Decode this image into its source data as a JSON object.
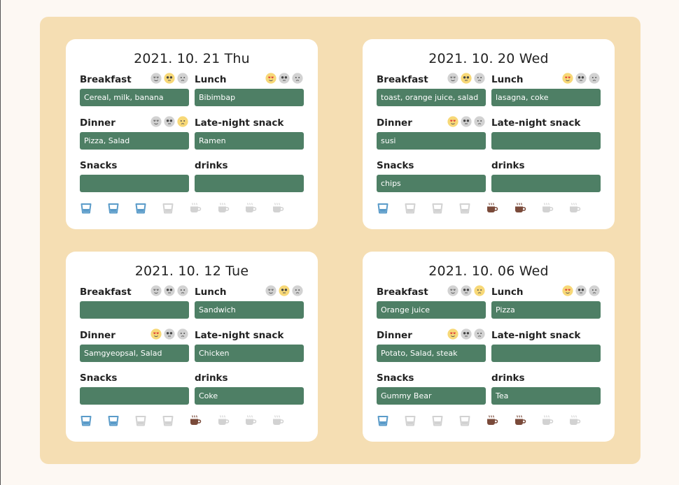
{
  "cards": [
    {
      "date": "2021. 10. 21 Thu",
      "breakfast": {
        "label": "Breakfast",
        "value": "Cereal, milk, banana",
        "mood": "soso"
      },
      "lunch": {
        "label": "Lunch",
        "value": "Bibimbap",
        "mood": "love"
      },
      "dinner": {
        "label": "Dinner",
        "value": "Pizza, Salad",
        "mood": "sad"
      },
      "late_night_snack": {
        "label": "Late-night snack",
        "value": "Ramen"
      },
      "snacks": {
        "label": "Snacks",
        "value": ""
      },
      "drinks": {
        "label": "drinks",
        "value": ""
      },
      "water_cups_filled": 3,
      "water_cups_total": 4,
      "coffee_cups_filled": 0,
      "coffee_cups_total": 4
    },
    {
      "date": "2021. 10. 20 Wed",
      "breakfast": {
        "label": "Breakfast",
        "value": "toast, orange juice, salad",
        "mood": "soso"
      },
      "lunch": {
        "label": "Lunch",
        "value": "lasagna, coke",
        "mood": "love"
      },
      "dinner": {
        "label": "Dinner",
        "value": "susi",
        "mood": "love"
      },
      "late_night_snack": {
        "label": "Late-night snack",
        "value": ""
      },
      "snacks": {
        "label": "Snacks",
        "value": "chips"
      },
      "drinks": {
        "label": "drinks",
        "value": ""
      },
      "water_cups_filled": 1,
      "water_cups_total": 4,
      "coffee_cups_filled": 2,
      "coffee_cups_total": 4
    },
    {
      "date": "2021. 10. 12 Tue",
      "breakfast": {
        "label": "Breakfast",
        "value": "",
        "mood": "none"
      },
      "lunch": {
        "label": "Lunch",
        "value": "Sandwich",
        "mood": "soso"
      },
      "dinner": {
        "label": "Dinner",
        "value": "Samgyeopsal, Salad",
        "mood": "love"
      },
      "late_night_snack": {
        "label": "Late-night snack",
        "value": "Chicken"
      },
      "snacks": {
        "label": "Snacks",
        "value": ""
      },
      "drinks": {
        "label": "drinks",
        "value": "Coke"
      },
      "water_cups_filled": 2,
      "water_cups_total": 4,
      "coffee_cups_filled": 1,
      "coffee_cups_total": 4
    },
    {
      "date": "2021. 10. 06 Wed",
      "breakfast": {
        "label": "Breakfast",
        "value": "Orange juice",
        "mood": "sad"
      },
      "lunch": {
        "label": "Lunch",
        "value": "Pizza",
        "mood": "love"
      },
      "dinner": {
        "label": "Dinner",
        "value": "Potato, Salad, steak",
        "mood": "love"
      },
      "late_night_snack": {
        "label": "Late-night snack",
        "value": ""
      },
      "snacks": {
        "label": "Snacks",
        "value": "Gummy Bear"
      },
      "drinks": {
        "label": "drinks",
        "value": "Tea"
      },
      "water_cups_filled": 1,
      "water_cups_total": 4,
      "coffee_cups_filled": 2,
      "coffee_cups_total": 4
    }
  ],
  "colors": {
    "board": "#f5deb3",
    "field_fill": "#4e7f65",
    "water_active": "#5a9bc9",
    "coffee_active": "#7a4a3a",
    "inactive": "#d2d2d2",
    "face_active": "#f7d877"
  },
  "icons": {
    "mood": [
      "love-face-icon",
      "soso-face-icon",
      "sad-face-icon"
    ],
    "water": "water-glass-icon",
    "coffee": "coffee-cup-icon"
  }
}
